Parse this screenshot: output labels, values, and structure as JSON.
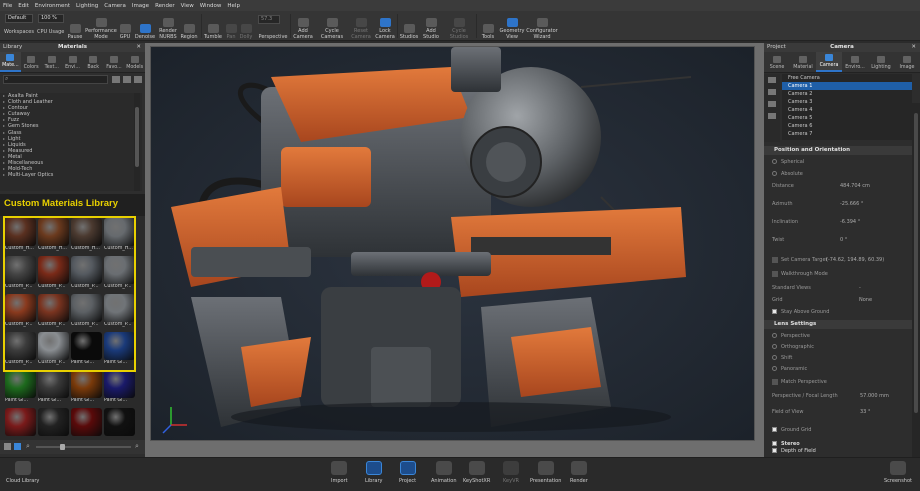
{
  "menubar": [
    "File",
    "Edit",
    "Environment",
    "Lighting",
    "Camera",
    "Image",
    "Render",
    "View",
    "Window",
    "Help"
  ],
  "toolbar": {
    "workspace_value": "Default",
    "workspaces_label": "Workspaces",
    "cpu_value": "100 %",
    "cpu_label": "CPU Usage",
    "pause": "Pause",
    "performance": "Performance Mode",
    "gpu": "GPU",
    "denoise": "Denoise",
    "render_nurbs": "Render NURBS",
    "region": "Region",
    "tumble": "Tumble",
    "pan": "Pan",
    "dolly": "Dolly",
    "fov_value": "57.3",
    "perspective": "Perspective",
    "add_camera": "Add Camera",
    "cycle_cameras": "Cycle Cameras",
    "reset_camera": "Reset Camera",
    "lock_camera": "Lock Camera",
    "studios": "Studios",
    "add_studio": "Add Studio",
    "cycle_studios": "Cycle Studios",
    "tools": "Tools",
    "geometry_view": "Geometry View",
    "configurator": "Configurator Wizard"
  },
  "library": {
    "header": "Library",
    "title": "Materials",
    "tabs": [
      "Mate...",
      "Colors",
      "Text...",
      "Envi...",
      "Back",
      "Favo...",
      "Models"
    ],
    "search_placeholder": "",
    "categories": [
      "Axalta Paint",
      "Cloth and Leather",
      "Contour",
      "Cutaway",
      "Fuzz",
      "Gem Stones",
      "Glass",
      "Light",
      "Liquids",
      "Measured",
      "Metal",
      "Miscellaneous",
      "Mold-Tech",
      "Multi-Layer Optics"
    ],
    "custom_title": "Custom Materials Library",
    "thumbs": [
      {
        "cap": "Custom_H...",
        "color": "#5a3020"
      },
      {
        "cap": "Custom_H...",
        "color": "#6b3a1e"
      },
      {
        "cap": "Custom_H...",
        "color": "#4b3a30"
      },
      {
        "cap": "Custom_H...",
        "color": "#666a6e"
      },
      {
        "cap": "Custom_P...",
        "color": "#444"
      },
      {
        "cap": "Custom_P...",
        "color": "#7a2a18"
      },
      {
        "cap": "Custom_P...",
        "color": "#555a60"
      },
      {
        "cap": "Custom_P...",
        "color": "#6a6e72"
      },
      {
        "cap": "Custom_P...",
        "color": "#8a3a1e"
      },
      {
        "cap": "Custom_P...",
        "color": "#7a3420"
      },
      {
        "cap": "Custom_P...",
        "color": "#5c6064"
      },
      {
        "cap": "Custom_P...",
        "color": "#707478"
      },
      {
        "cap": "Custom_P...",
        "color": "#3c3c3c"
      },
      {
        "cap": "Custom_P...",
        "color": "#8a8e92"
      },
      {
        "cap": "Paint Gl...",
        "color": "#0a0a0a"
      },
      {
        "cap": "Paint Gl...",
        "color": "#1a3a7a"
      },
      {
        "cap": "Paint Gl...",
        "color": "#1d6a1d"
      },
      {
        "cap": "Paint Gl...",
        "color": "#3a3a3a"
      },
      {
        "cap": "Paint Gl...",
        "color": "#7a3a0a"
      },
      {
        "cap": "Paint Gl...",
        "color": "#1a1a6a"
      },
      {
        "cap": "",
        "color": "#7a1a1a"
      },
      {
        "cap": "",
        "color": "#222"
      },
      {
        "cap": "",
        "color": "#5a0a0a"
      },
      {
        "cap": "",
        "color": "#111"
      }
    ],
    "cloud": "Cloud Library"
  },
  "project": {
    "header": "Project",
    "title": "Camera",
    "tabs": [
      "Scene",
      "Material",
      "Camera",
      "Enviro...",
      "Lighting",
      "Image"
    ],
    "cameras": [
      "Free Camera",
      "Camera 1",
      "Camera 2",
      "Camera 3",
      "Camera 4",
      "Camera 5",
      "Camera 6",
      "Camera 7"
    ],
    "position_section": "Position and Orientation",
    "spherical": "Spherical",
    "absolute": "Absolute",
    "distance_label": "Distance",
    "distance_value": "484.704 cm",
    "azimuth_label": "Azimuth",
    "azimuth_value": "-25.666 °",
    "inclination_label": "Inclination",
    "inclination_value": "-6.394 °",
    "twist_label": "Twist",
    "twist_value": "0 °",
    "set_target": "Set Camera Target",
    "target_value": "(-74.62, 194.89, 60.39)",
    "walkthrough": "Walkthrough Mode",
    "standard_views_label": "Standard Views",
    "standard_views_value": "-",
    "grid_label": "Grid",
    "grid_value": "None",
    "stay_above": "Stay Above Ground",
    "lens_section": "Lens Settings",
    "perspective": "Perspective",
    "orthographic": "Orthographic",
    "shift": "Shift",
    "panoramic": "Panoramic",
    "match_perspective": "Match Perspective",
    "focal_label": "Perspective / Focal Length",
    "focal_value": "57.000 mm",
    "fov_label": "Field of View",
    "fov_value": "33 °",
    "ground_grid": "Ground Grid",
    "stereo": "Stereo",
    "dof": "Depth of Field"
  },
  "bottombar": {
    "import": "Import",
    "library": "Library",
    "project": "Project",
    "animation": "Animation",
    "keyshotxr": "KeyShotXR",
    "keyvr": "KeyVR",
    "presentation": "Presentation",
    "render": "Render",
    "screenshot": "Screenshot"
  },
  "colors": {
    "accent": "#2e74c9",
    "highlight_yellow": "#e8d000",
    "robot_orange": "#d7682e"
  }
}
